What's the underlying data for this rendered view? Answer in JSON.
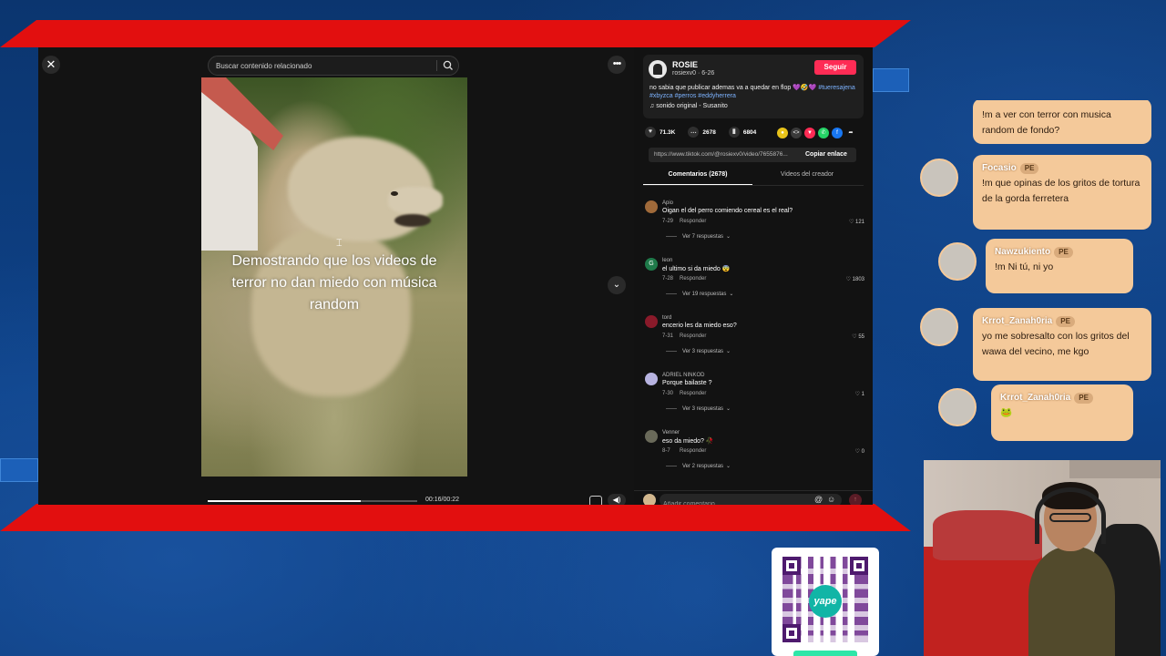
{
  "player": {
    "search_placeholder": "Buscar contenido relacionado",
    "close_glyph": "✕",
    "more_glyph": "•••",
    "video_caption": "Demostrando que los videos de terror no dan miedo con música random",
    "time": "00:16/00:22",
    "progress": 0.73,
    "next_glyph": "⌄"
  },
  "author": {
    "name": "ROSIE",
    "sub": "rosiexv0 · 6-26",
    "follow_label": "Seguir",
    "description": "no sabia que publicar ademas va a quedar en flop 💜🤣💜",
    "tags": "#tueresajena #xbyzca #perros #eddyherrera",
    "sound": "♫  sonido original - Susanito"
  },
  "stats": {
    "likes": "71.3K",
    "comments": "2678",
    "saves": "6804"
  },
  "share": {
    "link": "https://www.tiktok.com/@rosiexv0/video/7655876...",
    "copy_label": "Copiar enlace"
  },
  "tabs": {
    "comments": "Comentarios (2678)",
    "creator": "Videos del creador"
  },
  "comments": [
    {
      "user": "Apio",
      "text": "Oigan el del perro comiendo cereal es el real?",
      "date": "7-29",
      "reply": "Responder",
      "likes": "121",
      "more": "Ver 7 respuestas",
      "avatar_color": "#a06a3a",
      "avatar_letter": ""
    },
    {
      "user": "leon",
      "text": "el ultimo si da miedo 😨",
      "date": "7-28",
      "reply": "Responder",
      "likes": "1803",
      "more": "Ver 19 respuestas",
      "avatar_color": "#1f7a4a",
      "avatar_letter": "G"
    },
    {
      "user": "tord",
      "text": "encerio les da miedo eso?",
      "date": "7-31",
      "reply": "Responder",
      "likes": "55",
      "more": "Ver 3 respuestas",
      "avatar_color": "#8a1a2a",
      "avatar_letter": ""
    },
    {
      "user": "ADRIEL NINKOD",
      "text": "Porque bailaste ?",
      "date": "7-30",
      "reply": "Responder",
      "likes": "1",
      "more": "Ver 3 respuestas",
      "avatar_color": "#b7b3e0",
      "avatar_letter": ""
    },
    {
      "user": "Venner",
      "text": "eso da miedo? 🥀",
      "date": "8-7",
      "reply": "Responder",
      "likes": "0",
      "more": "Ver 2 respuestas",
      "avatar_color": "#6a6a5a",
      "avatar_letter": ""
    }
  ],
  "comment_input": {
    "placeholder": "Añadir comentario..."
  },
  "chat": [
    {
      "user": "",
      "badge": "",
      "text": "!m a ver con terror con musica random de fondo?"
    },
    {
      "user": "Focasio",
      "badge": "PE",
      "text": "!m que opinas de los gritos de tortura de la gorda ferretera"
    },
    {
      "user": "Nawzukiento",
      "badge": "PE",
      "text": "!m Ni tú, ni yo"
    },
    {
      "user": "Krrot_Zanah0ria",
      "badge": "PE",
      "text": "yo me sobresalto con los gritos del wawa del vecino, me kgo"
    },
    {
      "user": "Krrot_Zanah0ria",
      "badge": "PE",
      "text": "🐸"
    }
  ],
  "qr": {
    "logo_text": "yape"
  },
  "colors": {
    "accent_red": "#e20f0f",
    "follow": "#fe2c55",
    "chat_bubble": "#f4c99a"
  }
}
